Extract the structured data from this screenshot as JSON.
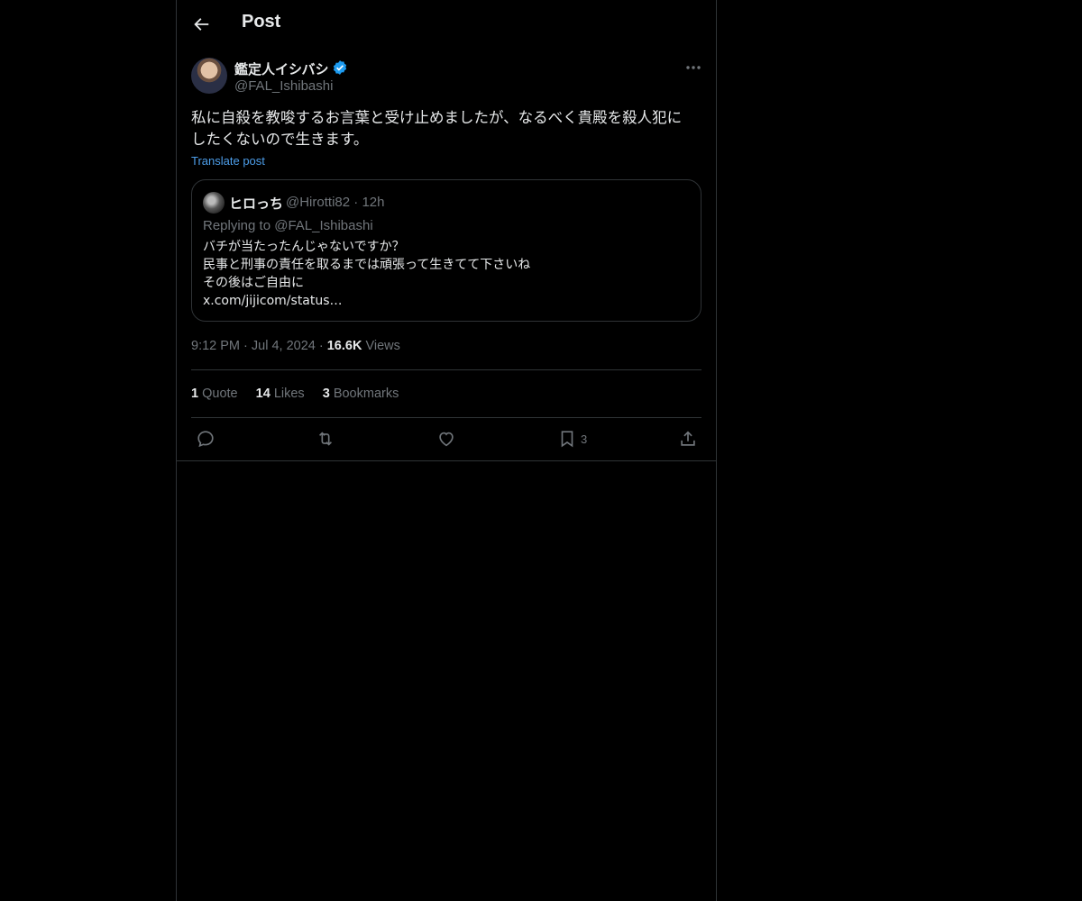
{
  "header": {
    "title": "Post"
  },
  "author": {
    "display_name": "鑑定人イシバシ",
    "handle": "@FAL_Ishibashi",
    "verified_color": "#1d9bf0"
  },
  "post": {
    "text_line1": "私に自殺を教唆するお言葉と受け止めましたが、なるべく貴殿を殺人犯に",
    "text_line2": "したくないので生きます。",
    "translate_label": "Translate post",
    "time": "9:12 PM",
    "date": "Jul 4, 2024",
    "views_count": "16.6K",
    "views_label": "Views"
  },
  "quoted": {
    "display_name": "ヒロっち",
    "handle": "@Hirotti82",
    "age": "12h",
    "replying_to": "Replying to @FAL_Ishibashi",
    "lines": [
      "バチが当たったんじゃないですか？",
      "民事と刑事の責任を取るまでは頑張って生きてて下さいね",
      "その後はご自由に",
      "x.com/jijicom/status…"
    ]
  },
  "stats": [
    {
      "count": "1",
      "label": "Quote"
    },
    {
      "count": "14",
      "label": "Likes"
    },
    {
      "count": "3",
      "label": "Bookmarks"
    }
  ],
  "actions": {
    "reply_icon": "reply-icon",
    "retweet_icon": "retweet-icon",
    "like_icon": "heart-icon",
    "bookmark_icon": "bookmark-icon",
    "bookmark_count": "3",
    "share_icon": "share-icon"
  },
  "colors": {
    "background": "#000000",
    "text": "#e7e9ea",
    "muted": "#71767b",
    "link": "#4d9eea",
    "border": "#2f3336"
  }
}
